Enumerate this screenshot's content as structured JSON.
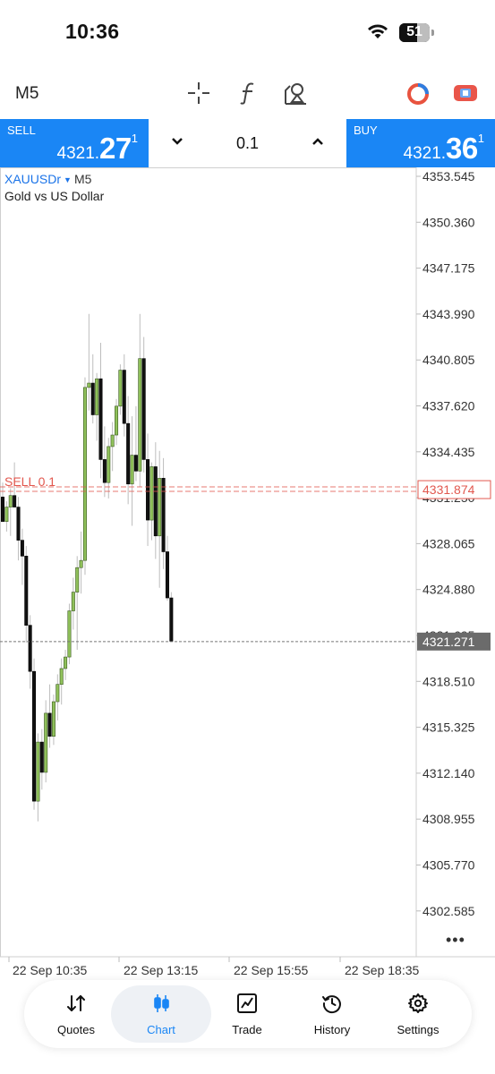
{
  "status_bar": {
    "time": "10:36",
    "battery": "51"
  },
  "toolbar": {
    "timeframe": "M5"
  },
  "trade": {
    "sell_label": "SELL",
    "sell_price_small": "4321.",
    "sell_price_big": "27",
    "sell_price_sup": "1",
    "buy_label": "BUY",
    "buy_price_small": "4321.",
    "buy_price_big": "36",
    "buy_price_sup": "1",
    "lot": "0.1"
  },
  "chart": {
    "symbol": "XAUUSDr",
    "timeframe": "M5",
    "description": "Gold vs US Dollar",
    "order_label": "SELL 0.1",
    "order_price_label": "4331.874",
    "current_price_label": "4321.271",
    "more_label": "•••"
  },
  "chart_data": {
    "type": "candlestick",
    "symbol": "XAUUSDr",
    "timeframe": "M5",
    "y_ticks": [
      "4353.545",
      "4350.360",
      "4347.175",
      "4343.990",
      "4340.805",
      "4337.620",
      "4334.435",
      "4331.250",
      "4328.065",
      "4324.880",
      "4321.695",
      "4318.510",
      "4315.325",
      "4312.140",
      "4308.955",
      "4305.770",
      "4302.585"
    ],
    "x_ticks": [
      "22 Sep 10:35",
      "22 Sep 13:15",
      "22 Sep 15:55",
      "22 Sep 18:35"
    ],
    "ylim": [
      4301.0,
      4355.0
    ],
    "order_line": {
      "label": "SELL 0.1",
      "price": 4331.874
    },
    "current_price": 4321.271,
    "colors": {
      "bull": "#8fc05a",
      "bear": "#111111",
      "wick": "#bdbdbd",
      "order": "#e2584f",
      "current_line": "#777777",
      "current_tag": "#6b6b6b"
    },
    "candles": [
      [
        4331.3,
        4332.3,
        4330.0,
        4329.6
      ],
      [
        4329.6,
        4331.0,
        4328.9,
        4330.6
      ],
      [
        4330.6,
        4331.9,
        4328.6,
        4331.4
      ],
      [
        4331.4,
        4333.7,
        4330.8,
        4330.6
      ],
      [
        4330.6,
        4331.3,
        4326.9,
        4328.3
      ],
      [
        4328.3,
        4329.1,
        4325.2,
        4327.2
      ],
      [
        4327.2,
        4327.9,
        4321.2,
        4322.4
      ],
      [
        4322.4,
        4323.1,
        4318.0,
        4319.2
      ],
      [
        4319.2,
        4320.1,
        4309.6,
        4310.2
      ],
      [
        4310.2,
        4314.9,
        4308.8,
        4314.3
      ],
      [
        4314.3,
        4315.2,
        4311.0,
        4312.2
      ],
      [
        4312.2,
        4317.2,
        4311.5,
        4316.3
      ],
      [
        4316.3,
        4318.3,
        4313.9,
        4314.7
      ],
      [
        4314.7,
        4317.6,
        4314.1,
        4317.1
      ],
      [
        4317.1,
        4319.0,
        4315.8,
        4318.3
      ],
      [
        4318.3,
        4320.1,
        4316.9,
        4319.4
      ],
      [
        4319.4,
        4320.7,
        4318.6,
        4320.2
      ],
      [
        4320.2,
        4323.9,
        4319.7,
        4323.4
      ],
      [
        4323.4,
        4325.7,
        4322.1,
        4324.7
      ],
      [
        4324.7,
        4327.2,
        4320.7,
        4326.4
      ],
      [
        4326.4,
        4328.9,
        4324.6,
        4326.9
      ],
      [
        4326.9,
        4339.6,
        4325.9,
        4338.9
      ],
      [
        4338.9,
        4344.0,
        4337.3,
        4339.2
      ],
      [
        4339.2,
        4341.2,
        4336.4,
        4337.0
      ],
      [
        4337.0,
        4339.9,
        4335.2,
        4339.5
      ],
      [
        4339.5,
        4342.0,
        4332.6,
        4333.9
      ],
      [
        4333.9,
        4336.2,
        4331.3,
        4332.3
      ],
      [
        4332.3,
        4335.4,
        4331.2,
        4334.8
      ],
      [
        4334.8,
        4336.5,
        4333.1,
        4335.6
      ],
      [
        4335.6,
        4338.1,
        4334.9,
        4337.6
      ],
      [
        4337.6,
        4340.5,
        4337.0,
        4340.1
      ],
      [
        4340.1,
        4341.2,
        4335.5,
        4336.4
      ],
      [
        4336.4,
        4338.3,
        4330.8,
        4332.2
      ],
      [
        4332.2,
        4336.9,
        4329.3,
        4334.2
      ],
      [
        4334.2,
        4337.6,
        4332.4,
        4333.1
      ],
      [
        4333.1,
        4344.0,
        4332.0,
        4340.9
      ],
      [
        4340.9,
        4342.4,
        4333.0,
        4333.9
      ],
      [
        4333.9,
        4335.7,
        4327.9,
        4329.7
      ],
      [
        4329.7,
        4333.7,
        4328.3,
        4333.4
      ],
      [
        4333.4,
        4335.1,
        4327.0,
        4328.6
      ],
      [
        4328.6,
        4334.5,
        4325.0,
        4332.6
      ],
      [
        4332.6,
        4334.0,
        4326.3,
        4327.5
      ],
      [
        4327.5,
        4328.6,
        4324.1,
        4324.3
      ],
      [
        4324.3,
        4324.7,
        4321.3,
        4321.3
      ]
    ]
  },
  "nav": {
    "items": [
      {
        "label": "Quotes",
        "icon": "quotes-arrows-icon"
      },
      {
        "label": "Chart",
        "icon": "candles-icon"
      },
      {
        "label": "Trade",
        "icon": "trade-chart-icon"
      },
      {
        "label": "History",
        "icon": "history-clock-icon"
      },
      {
        "label": "Settings",
        "icon": "gear-icon"
      }
    ],
    "active": "Chart"
  }
}
